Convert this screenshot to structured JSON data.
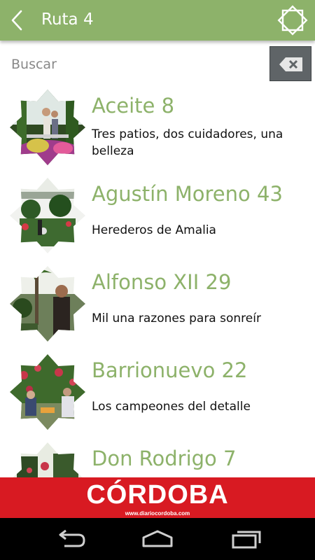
{
  "header": {
    "title": "Ruta 4",
    "back_icon": "chevron-left-icon",
    "logo_icon": "star-octagon-logo-icon",
    "color": "#8db26a"
  },
  "search": {
    "placeholder": "Buscar",
    "value": "",
    "clear_icon": "backspace-clear-icon"
  },
  "patios": [
    {
      "title": "Aceite 8",
      "subtitle": "Tres patios, dos cuidadores, una belleza"
    },
    {
      "title": "Agustín Moreno 43",
      "subtitle": "Herederos de Amalia"
    },
    {
      "title": "Alfonso XII 29",
      "subtitle": "Mil una razones para sonreír"
    },
    {
      "title": "Barrionuevo 22",
      "subtitle": "Los campeones del detalle"
    },
    {
      "title": "Don Rodrigo 7",
      "subtitle": ""
    }
  ],
  "banner": {
    "name": "CÓRDOBA",
    "url": "www.diariocordoba.com",
    "color": "#d81a22"
  },
  "navbar": {
    "back_icon": "back-arrow-icon",
    "home_icon": "home-icon",
    "recents_icon": "recent-apps-icon"
  }
}
